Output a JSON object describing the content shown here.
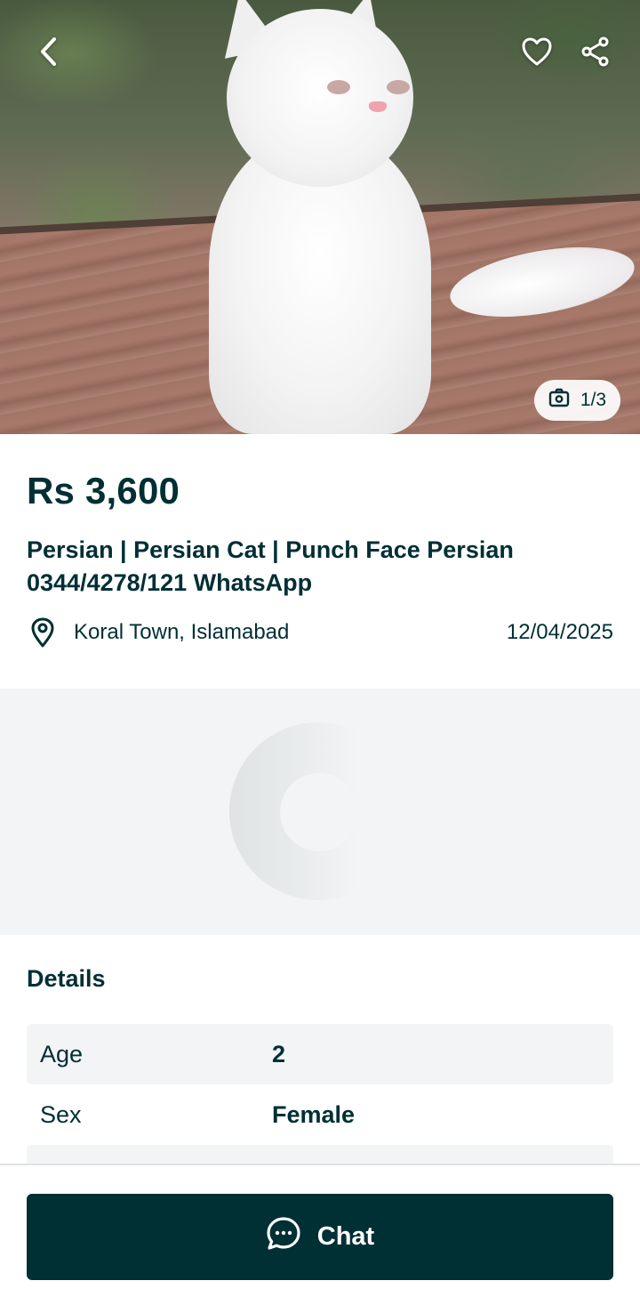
{
  "hero": {
    "photo_counter": "1/3",
    "icons": {
      "back": "chevron-left-icon",
      "favorite": "heart-icon",
      "share": "share-icon",
      "camera": "camera-icon"
    }
  },
  "listing": {
    "price": "Rs 3,600",
    "title": "Persian  | Persian Cat | Punch Face Persian 0344/4278/121 WhatsApp",
    "location": "Koral Town, Islamabad",
    "date": "12/04/2025"
  },
  "details": {
    "heading": "Details",
    "rows": [
      {
        "key": "Age",
        "value": "2"
      },
      {
        "key": "Sex",
        "value": "Female"
      }
    ]
  },
  "actions": {
    "chat_label": "Chat"
  },
  "colors": {
    "primary": "#002f34",
    "surface_muted": "#f2f4f5",
    "white": "#ffffff"
  }
}
